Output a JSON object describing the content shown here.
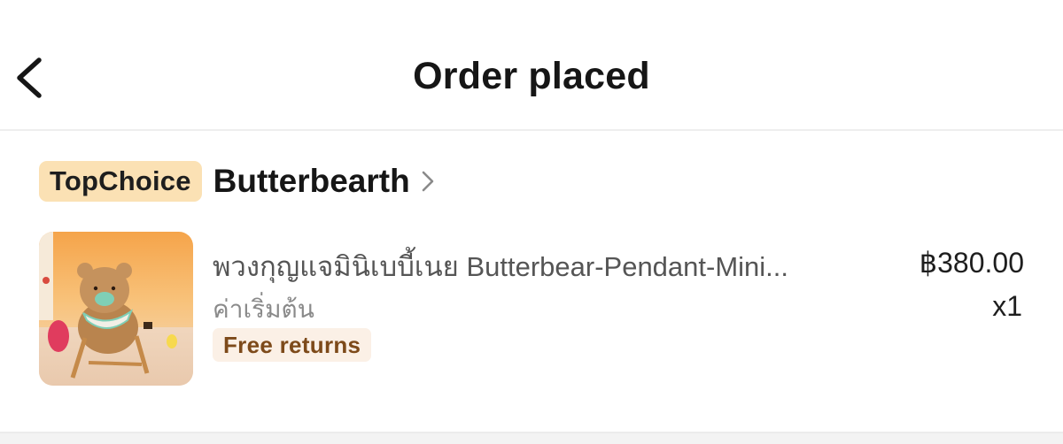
{
  "header": {
    "title": "Order placed",
    "back_icon": "chevron-left-icon"
  },
  "shop": {
    "badge": "TopChoice",
    "name": "Butterbearth",
    "chevron_icon": "chevron-right-icon",
    "badge_color": "#fbe1b4"
  },
  "item": {
    "image": "product-photo-bear-on-beach-chair",
    "name": "พวงกุญแจมินิเบบี้เนย Butterbear-Pendant-Mini...",
    "variant": "ค่าเริ่มต้น",
    "tag": "Free returns",
    "tag_bg_color": "#fbf0e6",
    "tag_text_color": "#7d4a1a",
    "price": "฿380.00",
    "quantity": "x1"
  }
}
